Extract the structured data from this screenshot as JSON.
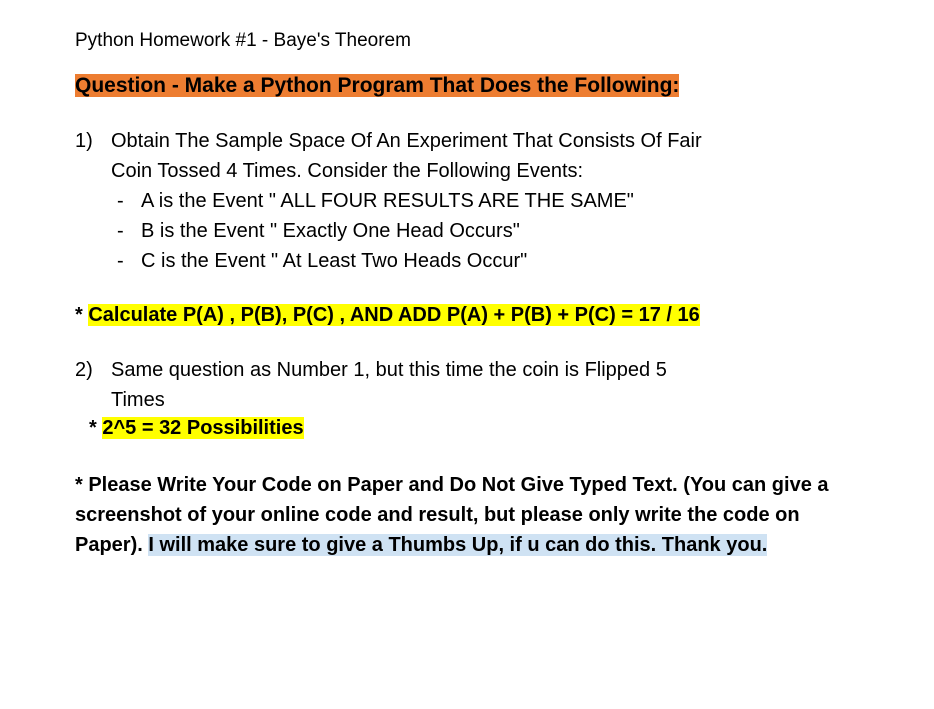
{
  "title": "Python Homework #1 - Baye's Theorem",
  "question_heading": "Question - Make a Python Program That Does the Following:",
  "q1": {
    "number": "1)",
    "intro_line1": "Obtain The Sample Space Of An Experiment That Consists Of Fair",
    "intro_line2": "Coin Tossed 4 Times. Consider the Following Events:",
    "events": [
      "A is the Event \" ALL FOUR RESULTS ARE THE SAME\"",
      "B is the Event \" Exactly One Head Occurs\"",
      "C is the Event \" At Least Two Heads Occur\""
    ]
  },
  "calc": {
    "prefix": "* ",
    "text": "Calculate P(A) , P(B), P(C) , AND ADD P(A) + P(B) + P(C) = 17 / 16"
  },
  "q2": {
    "number": "2)",
    "line1": "Same question as Number 1, but this time the coin is Flipped 5",
    "line2": "Times"
  },
  "possibilities": {
    "prefix": "*  ",
    "text": "2^5 = 32 Possibilities"
  },
  "instructions": {
    "part1": "* Please Write Your Code on Paper and Do Not Give Typed Text. (You can give a screenshot of your online code and result, but please only write the code on Paper). ",
    "part2": "I will make sure to give a Thumbs Up, if u can do this. Thank you."
  }
}
